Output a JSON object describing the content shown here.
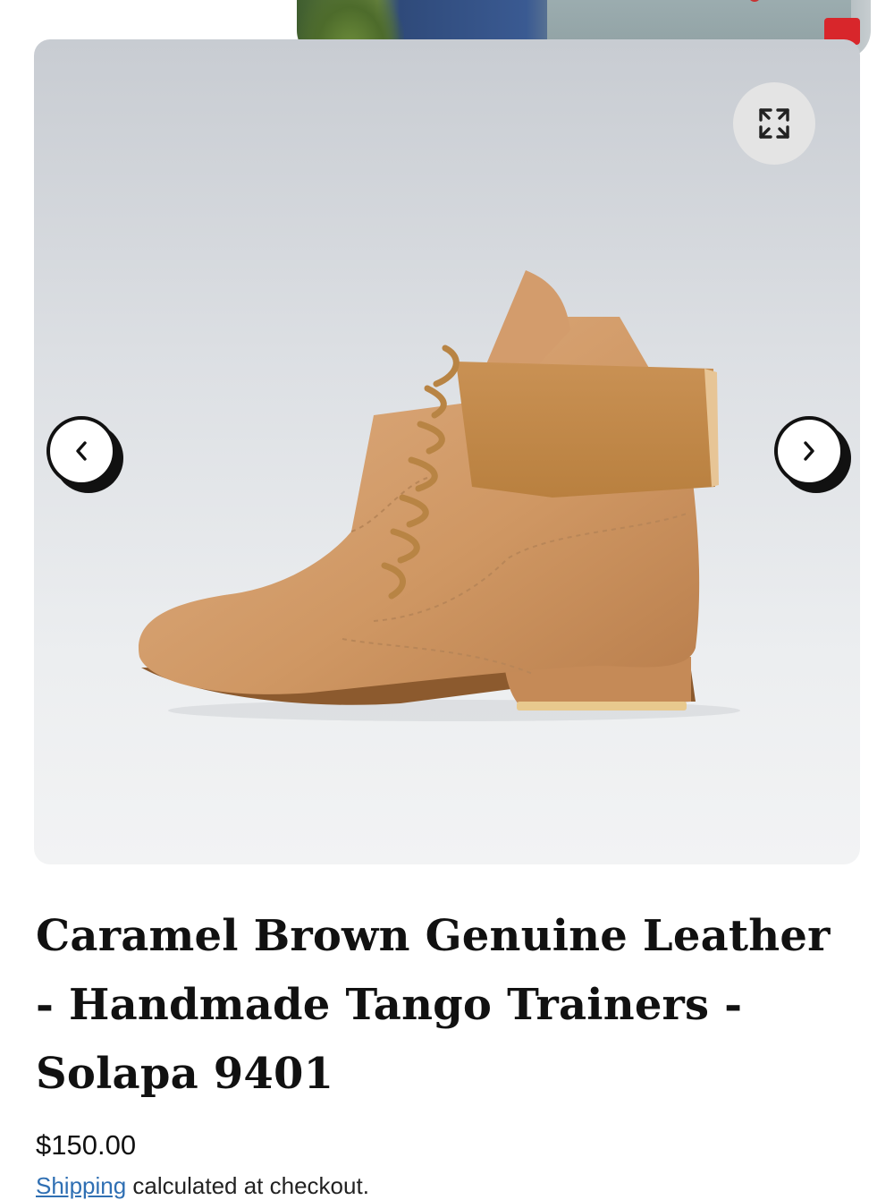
{
  "gallery": {
    "expand_icon": "expand-arrows-icon",
    "prev_icon": "chevron-left-icon",
    "next_icon": "chevron-right-icon"
  },
  "product": {
    "title": "Caramel Brown Genuine Leather - Handmade Tango Trainers - Solapa 9401",
    "price": "$150.00",
    "shipping_link": "Shipping",
    "shipping_rest": " calculated at checkout."
  },
  "colors": {
    "link": "#2f6fb3",
    "boot_leather": "#d29a6a",
    "boot_suede": "#c88d52"
  }
}
